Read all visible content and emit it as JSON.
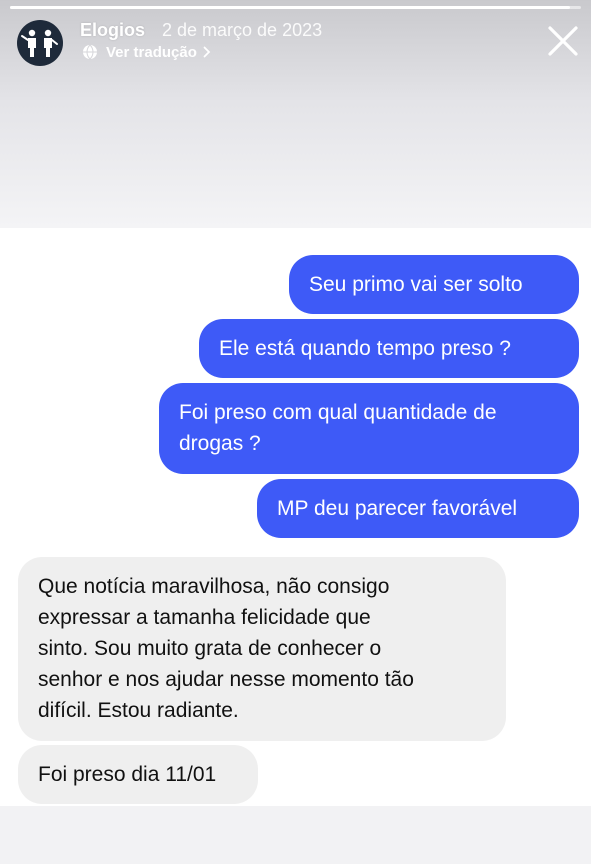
{
  "header": {
    "account_name": "Elogios",
    "date": "2 de março de 2023",
    "translate_label": "Ver tradução",
    "progress": 0.98,
    "avatar_icon": "two-people-icon",
    "close_icon": "close-icon"
  },
  "colors": {
    "outgoing_bubble": "#3e5af7",
    "incoming_bubble": "#efefef"
  },
  "messages": [
    {
      "direction": "outgoing",
      "lines": [
        "Seu primo vai ser solto"
      ]
    },
    {
      "direction": "outgoing",
      "lines": [
        "Ele está quando tempo preso ?"
      ]
    },
    {
      "direction": "outgoing",
      "lines": [
        "Foi preso com qual quantidade de",
        "drogas ?"
      ]
    },
    {
      "direction": "outgoing",
      "lines": [
        "MP deu parecer favorável"
      ]
    },
    {
      "direction": "incoming",
      "lines": [
        "Que notícia maravilhosa, não consigo",
        "expressar a tamanha felicidade que",
        "sinto. Sou muito grata de conhecer o",
        "senhor e nos ajudar nesse momento tão",
        "difícil. Estou radiante."
      ]
    },
    {
      "direction": "incoming",
      "lines": [
        "Foi preso dia 11/01"
      ]
    }
  ]
}
